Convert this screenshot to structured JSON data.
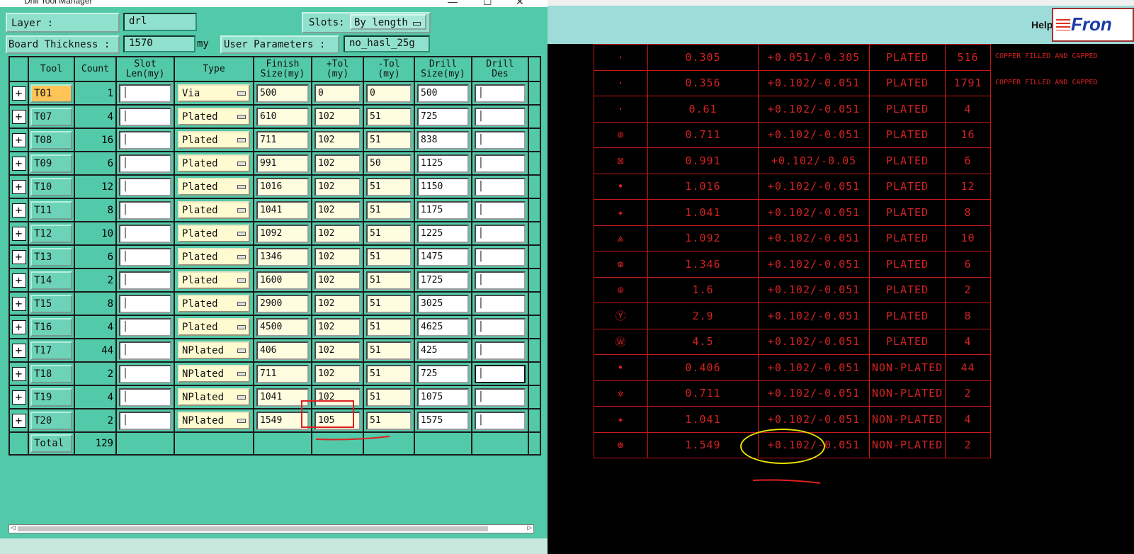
{
  "dialog": {
    "title": "Drill Tool Manager",
    "layer_label": "Layer        :",
    "layer_value": "drl",
    "slots_label": "Slots:",
    "slots_value": "By length",
    "thickness_label": "Board Thickness :",
    "thickness_value": "1570",
    "thickness_unit": "my",
    "user_params_label": "User Parameters :",
    "user_params_value": "no_hasl_25g"
  },
  "grid": {
    "headers": [
      "Tool",
      "Count",
      "Slot\nLen(my)",
      "Type",
      "Finish\nSize(my)",
      "+Tol\n(my)",
      "-Tol\n(my)",
      "Drill\nSize(my)",
      "Drill\nDes"
    ],
    "rows": [
      {
        "tool": "T01",
        "count": "1",
        "type": "Via",
        "finish": "500",
        "ptol": "0",
        "ntol": "0",
        "drill": "500"
      },
      {
        "tool": "T07",
        "count": "4",
        "type": "Plated",
        "finish": "610",
        "ptol": "102",
        "ntol": "51",
        "drill": "725"
      },
      {
        "tool": "T08",
        "count": "16",
        "type": "Plated",
        "finish": "711",
        "ptol": "102",
        "ntol": "51",
        "drill": "838"
      },
      {
        "tool": "T09",
        "count": "6",
        "type": "Plated",
        "finish": "991",
        "ptol": "102",
        "ntol": "50",
        "drill": "1125"
      },
      {
        "tool": "T10",
        "count": "12",
        "type": "Plated",
        "finish": "1016",
        "ptol": "102",
        "ntol": "51",
        "drill": "1150"
      },
      {
        "tool": "T11",
        "count": "8",
        "type": "Plated",
        "finish": "1041",
        "ptol": "102",
        "ntol": "51",
        "drill": "1175"
      },
      {
        "tool": "T12",
        "count": "10",
        "type": "Plated",
        "finish": "1092",
        "ptol": "102",
        "ntol": "51",
        "drill": "1225"
      },
      {
        "tool": "T13",
        "count": "6",
        "type": "Plated",
        "finish": "1346",
        "ptol": "102",
        "ntol": "51",
        "drill": "1475"
      },
      {
        "tool": "T14",
        "count": "2",
        "type": "Plated",
        "finish": "1600",
        "ptol": "102",
        "ntol": "51",
        "drill": "1725"
      },
      {
        "tool": "T15",
        "count": "8",
        "type": "Plated",
        "finish": "2900",
        "ptol": "102",
        "ntol": "51",
        "drill": "3025"
      },
      {
        "tool": "T16",
        "count": "4",
        "type": "Plated",
        "finish": "4500",
        "ptol": "102",
        "ntol": "51",
        "drill": "4625"
      },
      {
        "tool": "T17",
        "count": "44",
        "type": "NPlated",
        "finish": "406",
        "ptol": "102",
        "ntol": "51",
        "drill": "425"
      },
      {
        "tool": "T18",
        "count": "2",
        "type": "NPlated",
        "finish": "711",
        "ptol": "102",
        "ntol": "51",
        "drill": "725"
      },
      {
        "tool": "T19",
        "count": "4",
        "type": "NPlated",
        "finish": "1041",
        "ptol": "102",
        "ntol": "51",
        "drill": "1075"
      },
      {
        "tool": "T20",
        "count": "2",
        "type": "NPlated",
        "finish": "1549",
        "ptol": "105",
        "ntol": "51",
        "drill": "1575"
      }
    ],
    "total_label": "Total",
    "total_count": "129"
  },
  "right": {
    "help_label": "Help",
    "logo_text": "Fron",
    "notes": [
      "COPPER FILLED AND CAPPED",
      "COPPER FILLED AND CAPPED"
    ],
    "rows": [
      {
        "sym": "·",
        "size": "0.305",
        "tol": "+0.051/-0.305",
        "plating": "PLATED",
        "qty": "516"
      },
      {
        "sym": "·",
        "size": "0.356",
        "tol": "+0.102/-0.051",
        "plating": "PLATED",
        "qty": "1791"
      },
      {
        "sym": "·",
        "size": "0.61",
        "tol": "+0.102/-0.051",
        "plating": "PLATED",
        "qty": "4"
      },
      {
        "sym": "⊕",
        "size": "0.711",
        "tol": "+0.102/-0.051",
        "plating": "PLATED",
        "qty": "16"
      },
      {
        "sym": "⊠",
        "size": "0.991",
        "tol": "+0.102/-0.05",
        "plating": "PLATED",
        "qty": "6"
      },
      {
        "sym": "•",
        "size": "1.016",
        "tol": "+0.102/-0.051",
        "plating": "PLATED",
        "qty": "12"
      },
      {
        "sym": "✦",
        "size": "1.041",
        "tol": "+0.102/-0.051",
        "plating": "PLATED",
        "qty": "8"
      },
      {
        "sym": "⩓",
        "size": "1.092",
        "tol": "+0.102/-0.051",
        "plating": "PLATED",
        "qty": "10"
      },
      {
        "sym": "⊛",
        "size": "1.346",
        "tol": "+0.102/-0.051",
        "plating": "PLATED",
        "qty": "6"
      },
      {
        "sym": "⊕",
        "size": "1.6",
        "tol": "+0.102/-0.051",
        "plating": "PLATED",
        "qty": "2"
      },
      {
        "sym": "Ⓨ",
        "size": "2.9",
        "tol": "+0.102/-0.051",
        "plating": "PLATED",
        "qty": "8"
      },
      {
        "sym": "Ⓦ",
        "size": "4.5",
        "tol": "+0.102/-0.051",
        "plating": "PLATED",
        "qty": "4"
      },
      {
        "sym": "•",
        "size": "0.406",
        "tol": "+0.102/-0.051",
        "plating": "NON-PLATED",
        "qty": "44"
      },
      {
        "sym": "✲",
        "size": "0.711",
        "tol": "+0.102/-0.051",
        "plating": "NON-PLATED",
        "qty": "2"
      },
      {
        "sym": "✦",
        "size": "1.041",
        "tol": "+0.102/-0.051",
        "plating": "NON-PLATED",
        "qty": "4"
      },
      {
        "sym": "⊛",
        "size": "1.549",
        "tol": "+0.102/-0.051",
        "plating": "NON-PLATED",
        "qty": "2"
      }
    ]
  },
  "colors": {
    "dialog_bg": "#52c9a9",
    "input_bg": "#fffde0",
    "active_tool": "#ffc557",
    "drawing_text": "#d42222",
    "highlight_ellipse": "#e8e000",
    "annotation_red": "#e02020"
  }
}
